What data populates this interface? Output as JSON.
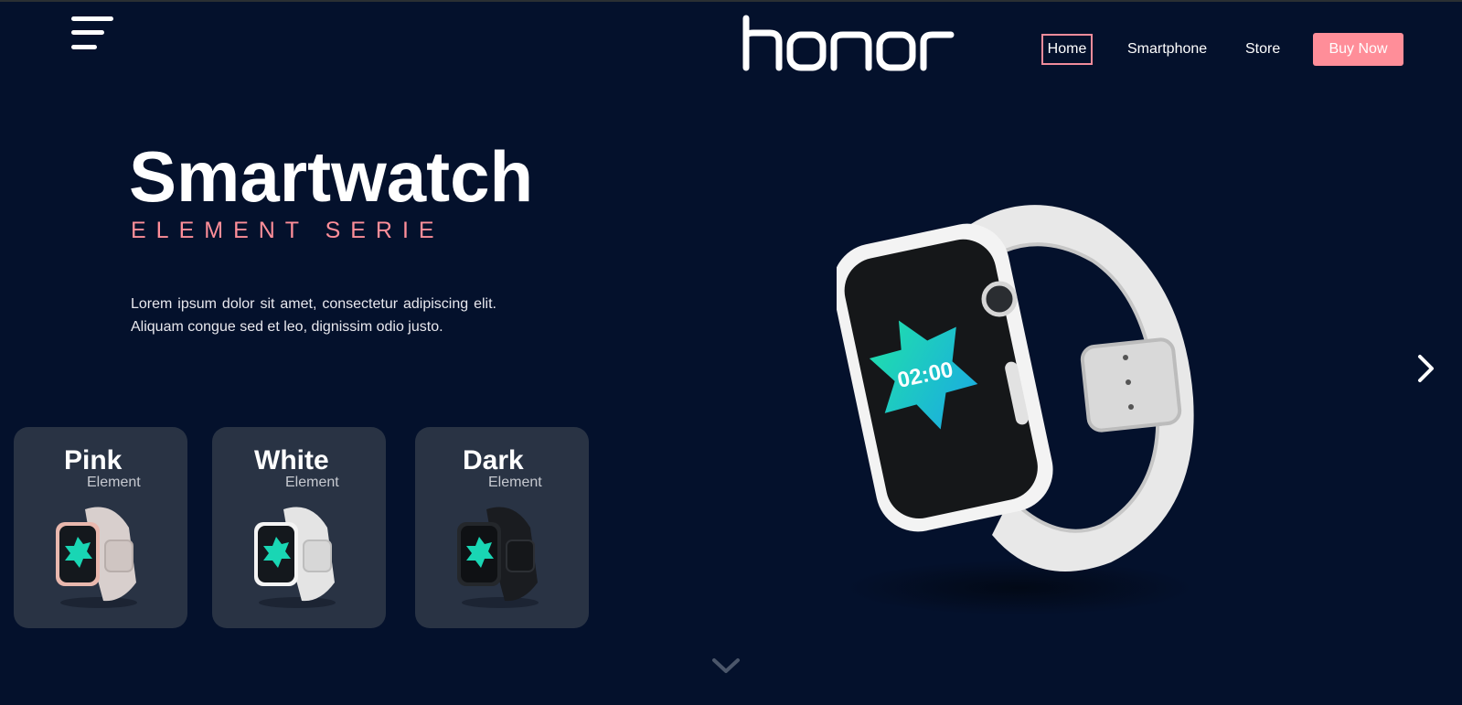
{
  "brand": {
    "logo": "honor"
  },
  "nav": {
    "items": [
      {
        "label": "Home"
      },
      {
        "label": "Smartphone"
      },
      {
        "label": "Store"
      }
    ],
    "cta": "Buy Now"
  },
  "hero": {
    "title": "Smartwatch",
    "subtitle": "ELEMENT SERIE",
    "description": "Lorem ipsum dolor sit amet, consectetur adipiscing elit. Aliquam congue sed et leo, dignissim odio justo.",
    "watch_screen_time": "02:00"
  },
  "variants": [
    {
      "name": "Pink",
      "sub": "Element"
    },
    {
      "name": "White",
      "sub": "Element"
    },
    {
      "name": "Dark",
      "sub": "Element"
    }
  ],
  "colors": {
    "background": "#04112c",
    "accent": "#ff8e99",
    "card": "#293344"
  },
  "icons": [
    "menu-icon",
    "chevron-right-icon",
    "chevron-down-icon"
  ]
}
